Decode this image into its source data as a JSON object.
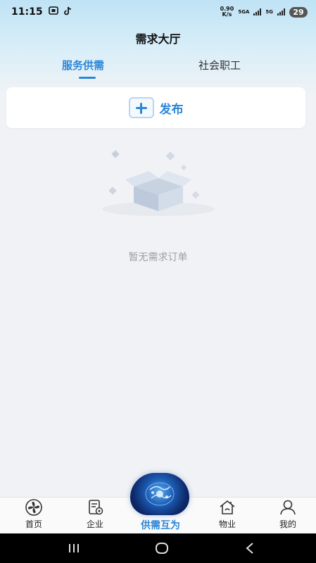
{
  "status_bar": {
    "time": "11:15",
    "net_speed_value": "0.90",
    "net_speed_unit": "K/s",
    "sim1_label": "5GA",
    "sim2_label": "5G",
    "battery": "29"
  },
  "header": {
    "title": "需求大厅"
  },
  "tabs": [
    {
      "label": "服务供需",
      "active": true
    },
    {
      "label": "社会职工",
      "active": false
    }
  ],
  "publish": {
    "label": "发布"
  },
  "empty_state": {
    "message": "暂无需求订单"
  },
  "bottom_nav": {
    "items": [
      {
        "label": "首页",
        "icon": "home-pinwheel-icon"
      },
      {
        "label": "企业",
        "icon": "company-doc-icon"
      },
      {
        "label": "供需互为",
        "icon": "globe-orb-icon",
        "center": true
      },
      {
        "label": "物业",
        "icon": "property-house-icon"
      },
      {
        "label": "我的",
        "icon": "user-profile-icon"
      }
    ]
  },
  "colors": {
    "accent": "#2c86d8",
    "background": "#f1f2f5",
    "header_gradient_top": "#bfe3f5"
  }
}
